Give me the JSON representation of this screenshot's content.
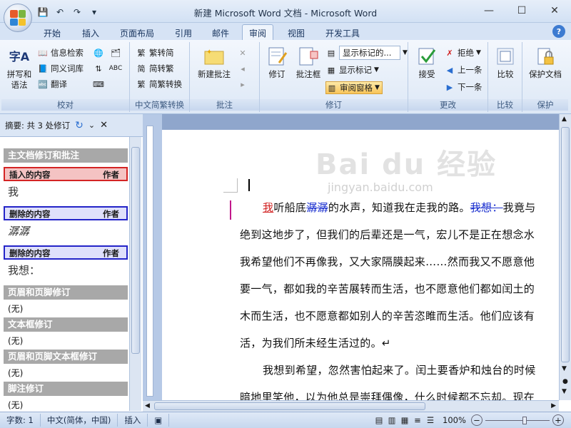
{
  "app": {
    "title": "新建 Microsoft Word 文档 - Microsoft Word"
  },
  "tabs": [
    {
      "label": "开始",
      "active": false
    },
    {
      "label": "插入",
      "active": false
    },
    {
      "label": "页面布局",
      "active": false
    },
    {
      "label": "引用",
      "active": false
    },
    {
      "label": "邮件",
      "active": false
    },
    {
      "label": "审阅",
      "active": true
    },
    {
      "label": "视图",
      "active": false
    },
    {
      "label": "开发工具",
      "active": false
    }
  ],
  "ribbon": {
    "proofing": {
      "label": "校对",
      "spell": "拼写和\n语法",
      "research": "信息检索",
      "thesaurus": "同义词库",
      "translate": "翻译"
    },
    "chinese": {
      "label": "中文简繁转换",
      "to_trad": "繁转简",
      "to_simp": "简转繁",
      "convert": "简繁转换"
    },
    "comments": {
      "label": "批注",
      "new": "新建批注"
    },
    "tracking": {
      "label": "修订",
      "track": "修订",
      "balloons": "批注框",
      "show_final": "显示标记的...",
      "show_markup": "显示标记",
      "review_pane": "审阅窗格"
    },
    "changes": {
      "label": "更改",
      "accept": "接受",
      "reject": "拒绝",
      "previous": "上一条",
      "next": "下一条"
    },
    "compare": {
      "label": "比较",
      "button": "比较"
    },
    "protect": {
      "label": "保护",
      "button": "保护文档"
    }
  },
  "review_pane": {
    "summary": "摘要: 共 3 处修订",
    "main_header": "主文档修订和批注",
    "items": [
      {
        "type": "插入的内容",
        "author": "作者",
        "text": "我"
      },
      {
        "type": "删除的内容",
        "author": "作者",
        "text": "潺潺"
      },
      {
        "type": "删除的内容",
        "author": "作者",
        "text": "我想："
      }
    ],
    "sections": [
      {
        "title": "页眉和页脚修订",
        "value": "(无)"
      },
      {
        "title": "文本框修订",
        "value": "(无)"
      },
      {
        "title": "页眉和页脚文本框修订",
        "value": "(无)"
      },
      {
        "title": "脚注修订",
        "value": "(无)"
      }
    ]
  },
  "document": {
    "lines": [
      {
        "pre": "",
        "ins": "我",
        "mid": "听船底",
        "del": "潺潺",
        "post": "的水声，知道我在走我的路。",
        "del2": "我想：",
        "tail": "我竟与"
      },
      {
        "text": "绝到这地步了，但我们的后辈还是一气，宏儿不是正在想念水"
      },
      {
        "text": "我希望他们不再像我，又大家隔膜起来……然而我又不愿意他"
      },
      {
        "text": "要一气，都如我的辛苦展转而生活，也不愿意他们都如闰土的"
      },
      {
        "text": "木而生活，也不愿意都如别人的辛苦恣睢而生活。他们应该有"
      },
      {
        "text": "活，为我们所未经生活过的。↵"
      },
      {
        "text": "我想到希望，忽然害怕起来了。闰土要香炉和烛台的时候"
      },
      {
        "text": "暗地里笑他，以为他总是崇拜偶像，什么时候都不忘却。现在"
      }
    ],
    "watermark": "Bai du 经验",
    "watermark_sub": "jingyan.baidu.com"
  },
  "status": {
    "words": "字数: 1",
    "lang": "中文(简体，中国)",
    "mode": "插入",
    "zoom": "100%"
  }
}
